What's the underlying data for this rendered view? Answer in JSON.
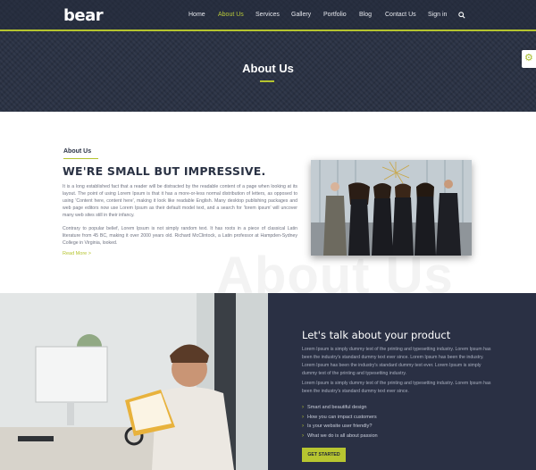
{
  "brand": {
    "logo_text": "bear"
  },
  "nav": {
    "items": [
      {
        "label": "Home"
      },
      {
        "label": "About Us"
      },
      {
        "label": "Services"
      },
      {
        "label": "Gallery"
      },
      {
        "label": "Portfolio"
      },
      {
        "label": "Blog"
      },
      {
        "label": "Contact Us"
      },
      {
        "label": "Sign in"
      }
    ],
    "active": "About Us",
    "search_icon": "search-icon"
  },
  "hero": {
    "title": "About Us"
  },
  "settings": {
    "icon": "gear-icon"
  },
  "about": {
    "label": "About Us",
    "heading": "WE'RE SMALL BUT IMPRESSIVE.",
    "paragraph1": "It is a long established fact that a reader will be distracted by the readable content of a page when looking at its layout. The point of using Lorem Ipsum is that it has a more-or-less normal distribution of letters, as opposed to using 'Content here, content here', making it look like readable English. Many desktop publishing packages and web page editors now use Lorem Ipsum as their default model text, and a search for 'lorem ipsum' will uncover many web sites still in their infancy.",
    "paragraph2": "Contrary to popular belief, Lorem Ipsum is not simply random text. It has roots in a piece of classical Latin literature from 45 BC, making it over 2000 years old. Richard McClintock, a Latin professor at Hampden-Sydney College in Virginia, looked.",
    "read_more": "Read More >",
    "watermark": "About Us"
  },
  "talk": {
    "title": "Let's talk about your product",
    "paragraph1": "Lorem Ipsum is simply dummy text of the printing and typesetting industry. Lorem Ipsum has been the industry's standard dummy text ever since. Lorem Ipsum has been the industry. Lorem Ipsum has been the industry's standard dummy text ever. Lorem Ipsum is simply dummy text of the printing and typesetting industry.",
    "paragraph2": "Lorem Ipsum is simply dummy text of the printing and typesetting industry. Lorem Ipsum has been the industry's standard dummy text ever since.",
    "features": [
      "Smart and beautiful design",
      "How you can impact customers",
      "Is your website user friendly?",
      "What we do is all about passion"
    ],
    "cta": "GET STARTED"
  },
  "colors": {
    "accent": "#b5c42f",
    "dark": "#2a3044",
    "hero_bg": "#2a3244"
  }
}
